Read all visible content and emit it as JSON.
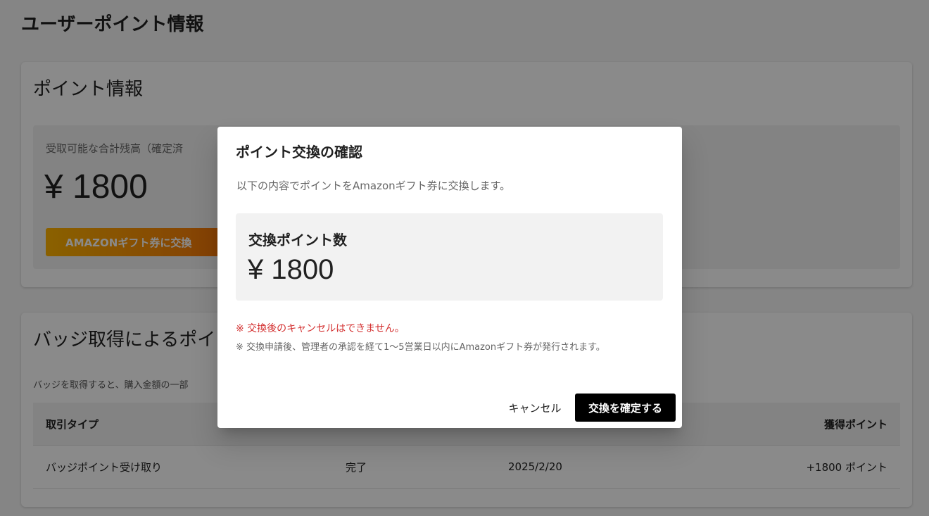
{
  "page": {
    "title": "ユーザーポイント情報"
  },
  "point_info": {
    "title": "ポイント情報",
    "balance_label": "受取可能な合計残高（確定済",
    "balance_amount": "¥ 1800",
    "exchange_button": "AMAZONギフト券に交換"
  },
  "badge_section": {
    "title": "バッジ取得によるポイ",
    "description": "バッジを取得すると、購入金額の一部",
    "table": {
      "headers": [
        "取引タイプ",
        "",
        "",
        "獲得ポイント"
      ],
      "rows": [
        {
          "type": "バッジポイント受け取り",
          "status": "完了",
          "date": "2025/2/20",
          "points": "+1800 ポイント"
        }
      ]
    }
  },
  "dialog": {
    "title": "ポイント交換の確認",
    "description": "以下の内容でポイントをAmazonギフト券に交換します。",
    "exchange_label": "交換ポイント数",
    "exchange_amount": "¥ 1800",
    "warning": "※ 交換後のキャンセルはできません。",
    "note": "※ 交換申請後、管理者の承認を経て1〜5営業日以内にAmazonギフト券が発行されます。",
    "cancel_label": "キャンセル",
    "confirm_label": "交換を確定する"
  }
}
